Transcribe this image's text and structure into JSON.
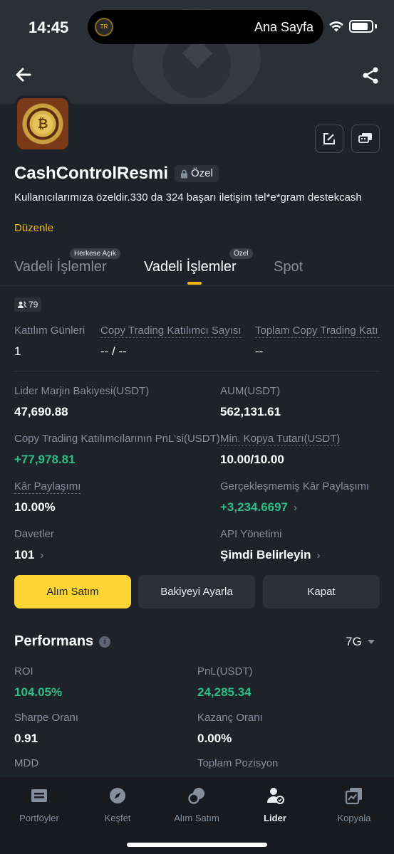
{
  "status_bar": {
    "time": "14:45",
    "island_badge": "TR",
    "island_label": "Ana Sayfa"
  },
  "profile": {
    "name": "CashControlResmi",
    "private_badge": "Özel",
    "bio": "Kullanıcılarımıza özeldir.330 da  324 başarı iletişim tel*e*gram destekcash",
    "edit_link": "Düzenle"
  },
  "tabs": [
    {
      "label": "Vadeli İşlemler",
      "badge": "Herkese Açık",
      "active": false
    },
    {
      "label": "Vadeli İşlemler",
      "badge": "Özel",
      "active": true
    },
    {
      "label": "Spot",
      "badge": "",
      "active": false
    }
  ],
  "follower_count": "79",
  "summary": {
    "join_days_label": "Katılım Günleri",
    "join_days_value": "1",
    "participants_label": "Copy Trading Katılımcı Sayısı",
    "participants_value": "-- / --",
    "total_label": "Toplam Copy Trading Katı",
    "total_value": "--"
  },
  "stats": {
    "margin_label": "Lider Marjin Bakiyesi(USDT)",
    "margin_value": "47,690.88",
    "aum_label": "AUM(USDT)",
    "aum_value": "562,131.61",
    "pnl_label": "Copy Trading Katılımcılarının PnL'si(USDT)",
    "pnl_value": "+77,978.81",
    "min_copy_label": "Min. Kopya Tutarı(USDT)",
    "min_copy_value": "10.00/10.00",
    "profit_share_label": "Kâr Paylaşımı",
    "profit_share_value": "10.00%",
    "unrealized_label": "Gerçekleşmemiş Kâr Paylaşımı",
    "unrealized_value": "+3,234.6697",
    "invites_label": "Davetler",
    "invites_value": "101",
    "api_label": "API Yönetimi",
    "api_value": "Şimdi Belirleyin"
  },
  "actions": {
    "trade": "Alım Satım",
    "adjust": "Bakiyeyi Ayarla",
    "close": "Kapat"
  },
  "performance": {
    "title": "Performans",
    "period": "7G",
    "roi_label": "ROI",
    "roi_value": "104.05%",
    "pnl_label": "PnL(USDT)",
    "pnl_value": "24,285.34",
    "sharpe_label": "Sharpe Oranı",
    "sharpe_value": "0.91",
    "win_label": "Kazanç Oranı",
    "win_value": "0.00%",
    "mdd_label": "MDD",
    "positions_label": "Toplam Pozisyon"
  },
  "nav": {
    "portfolios": "Portföyler",
    "discover": "Keşfet",
    "trade": "Alım Satım",
    "leader": "Lider",
    "copy": "Kopyala"
  },
  "colors": {
    "accent": "#fcd535",
    "positive": "#2ebd85",
    "background": "#1e2329"
  }
}
